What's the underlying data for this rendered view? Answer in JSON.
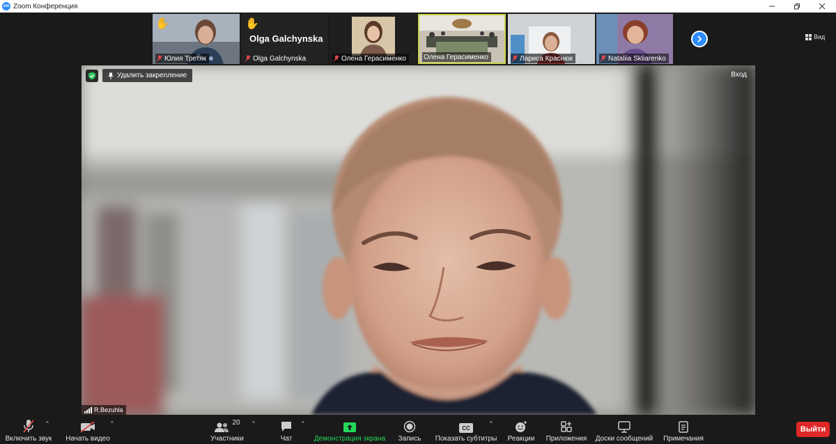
{
  "window": {
    "title": "Zoom Конференция",
    "app_logo_text": "zm"
  },
  "filmstrip": {
    "tiles": [
      {
        "name": "Юлия Третяк",
        "muted": true,
        "hand_raised": true,
        "video": true
      },
      {
        "name": "Olga Galchynska",
        "muted": true,
        "hand_raised": true,
        "video": false,
        "display_name": "Olga Galchynska"
      },
      {
        "name": "Олена Герасименко",
        "muted": true,
        "hand_raised": false,
        "video": true
      },
      {
        "name": "Олена Герасименко",
        "muted": false,
        "hand_raised": false,
        "video": true,
        "highlighted": true
      },
      {
        "name": "Лариса Краснюк",
        "muted": true,
        "hand_raised": false,
        "video": true
      },
      {
        "name": "Nataliia Skliarenko",
        "muted": true,
        "hand_raised": false,
        "video": true
      }
    ],
    "view_label": "Вид"
  },
  "main_video": {
    "unpin_label": "Удалить закрепление",
    "enter_label": "Вход",
    "speaker_name": "R.Bezuhla"
  },
  "toolbar": {
    "unmute": "Включить звук",
    "start_video": "Начать видео",
    "participants": "Участники",
    "participants_count": "20",
    "chat": "Чат",
    "share_screen": "Демонстрация экрана",
    "record": "Запись",
    "captions": "Показать субтитры",
    "captions_icon_text": "CC",
    "reactions": "Реакции",
    "apps": "Приложения",
    "whiteboards": "Доски сообщений",
    "notes": "Примечания",
    "leave": "Выйти"
  },
  "colors": {
    "accent": "#2d8cff",
    "share_green": "#23d959",
    "leave_red": "#e02828",
    "muted_red": "#e04848"
  }
}
